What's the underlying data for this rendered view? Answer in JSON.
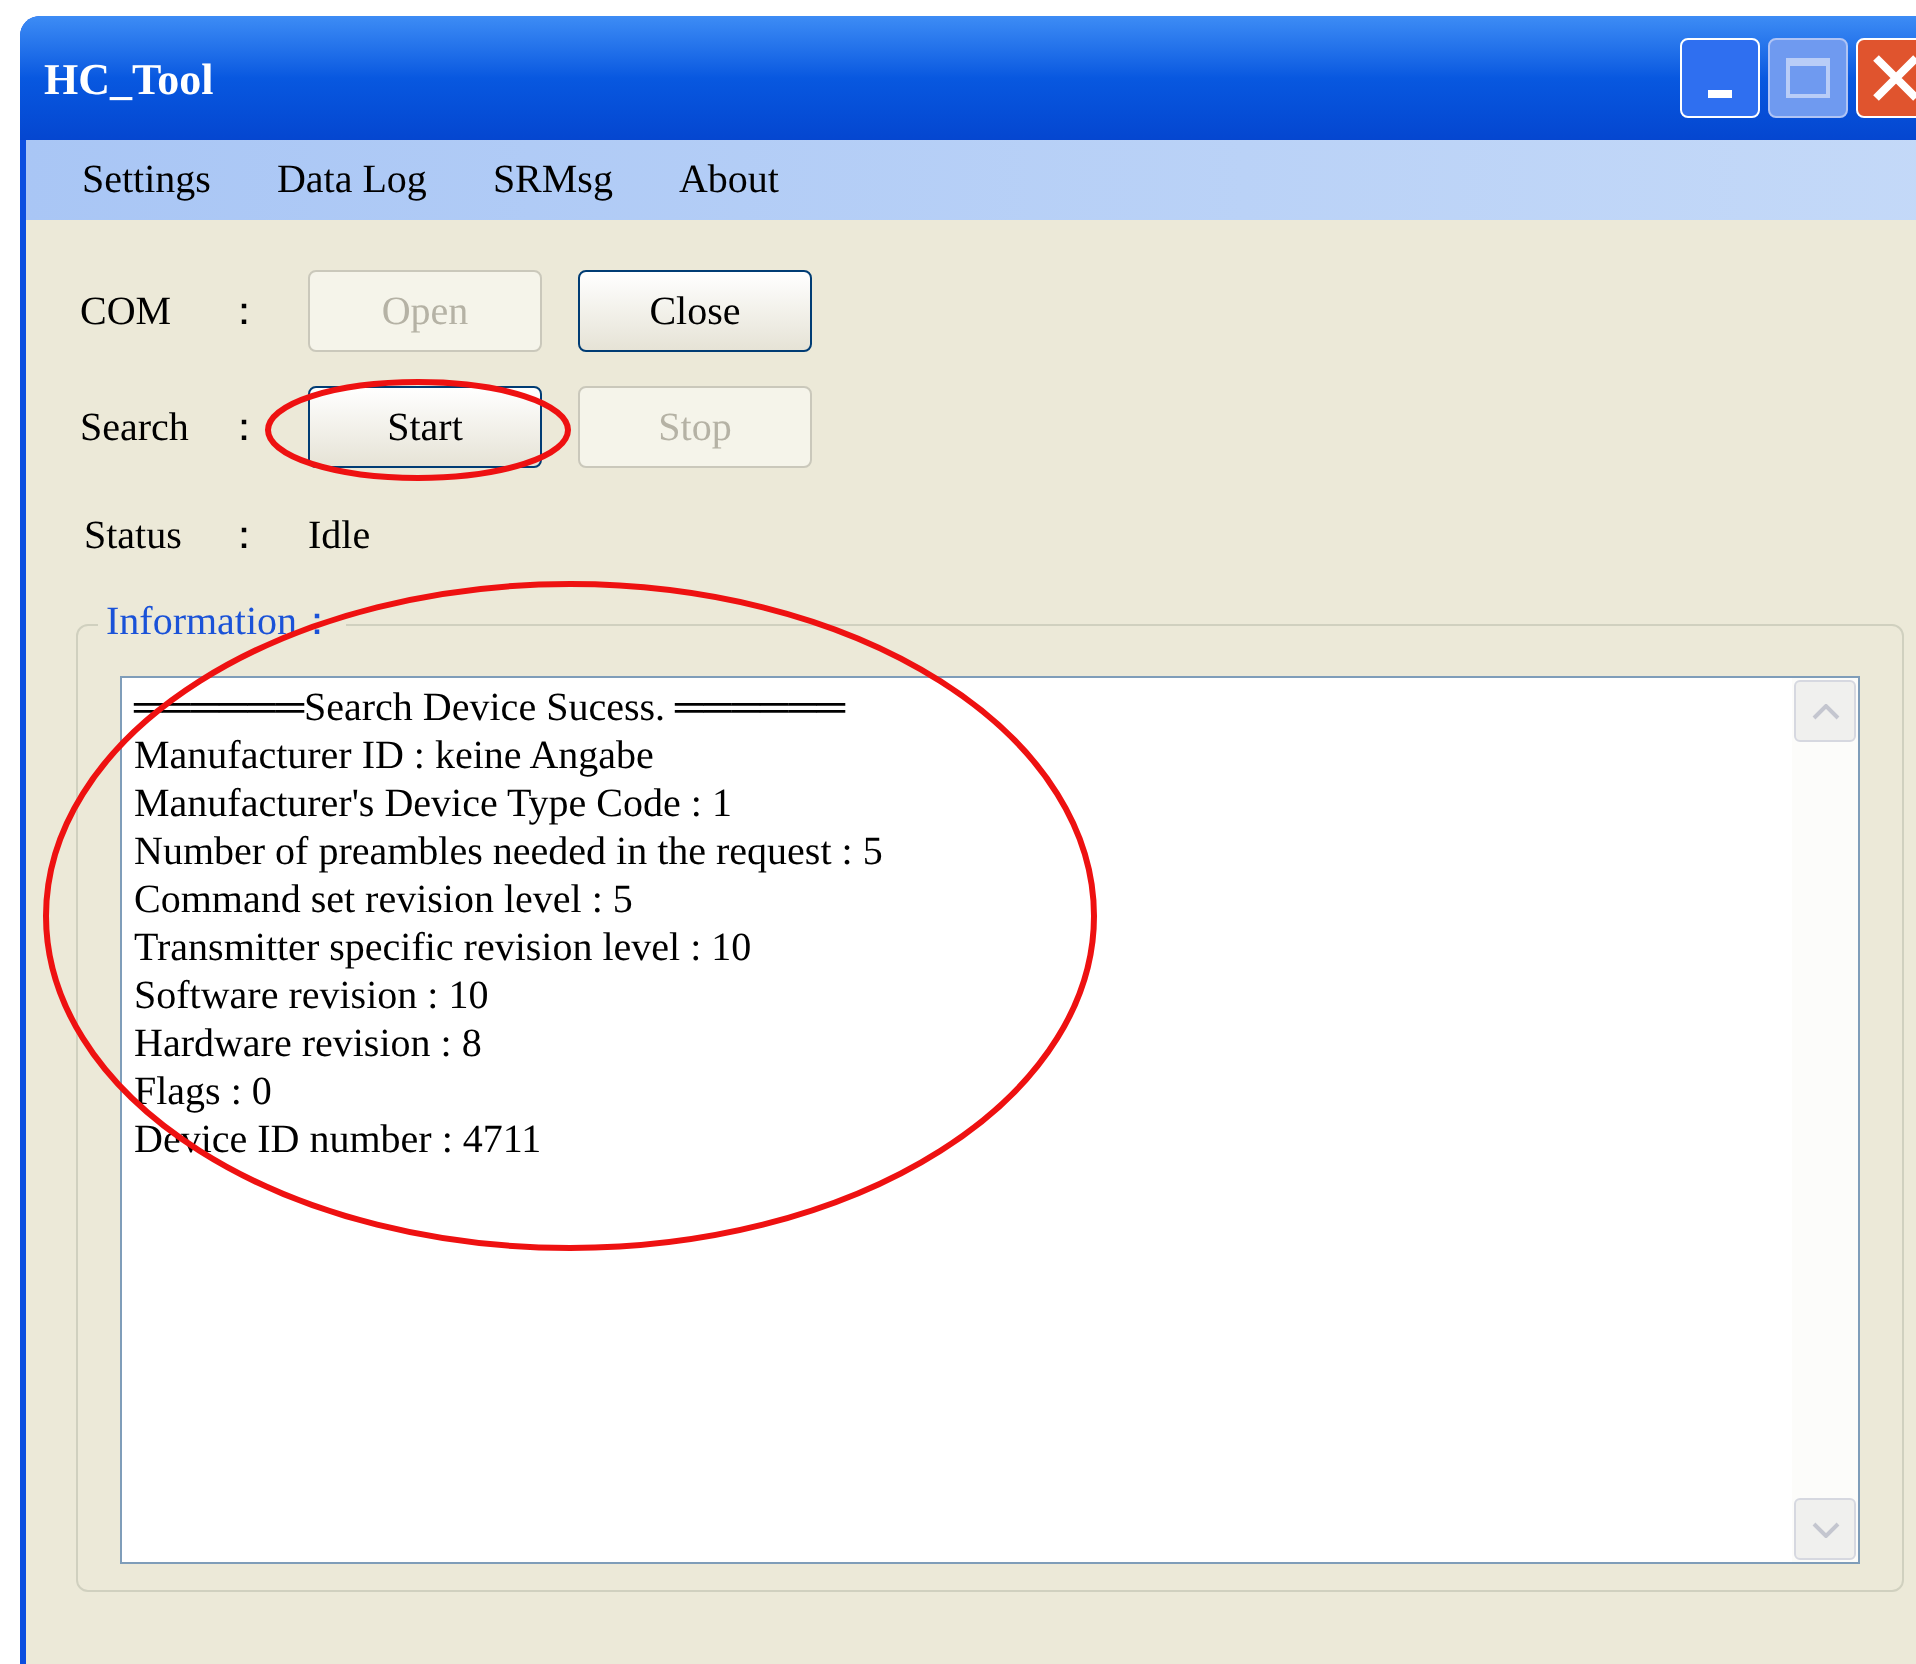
{
  "window": {
    "title": "HC_Tool"
  },
  "menu": [
    "Settings",
    "Data Log",
    "SRMsg",
    "About"
  ],
  "rows": [
    {
      "label": "COM",
      "colon": "：",
      "buttons": [
        {
          "label": "Open",
          "disabled": true
        },
        {
          "label": "Close",
          "disabled": false
        }
      ]
    },
    {
      "label": "Search",
      "colon": "：",
      "buttons": [
        {
          "label": "Start",
          "disabled": false
        },
        {
          "label": "Stop",
          "disabled": true
        }
      ]
    }
  ],
  "status": {
    "label": "Status",
    "colon": "：",
    "value": "Idle"
  },
  "information": {
    "title": "Information：",
    "lines": [
      "══════Search Device Sucess. ══════",
      "Manufacturer ID : keine Angabe",
      "Manufacturer's Device Type Code : 1",
      "Number of preambles needed in the request : 5",
      "Command set revision level : 5",
      "Transmitter specific revision level : 10",
      "Software revision : 10",
      "Hardware revision : 8",
      "Flags : 0",
      "Device ID number : 4711"
    ]
  }
}
